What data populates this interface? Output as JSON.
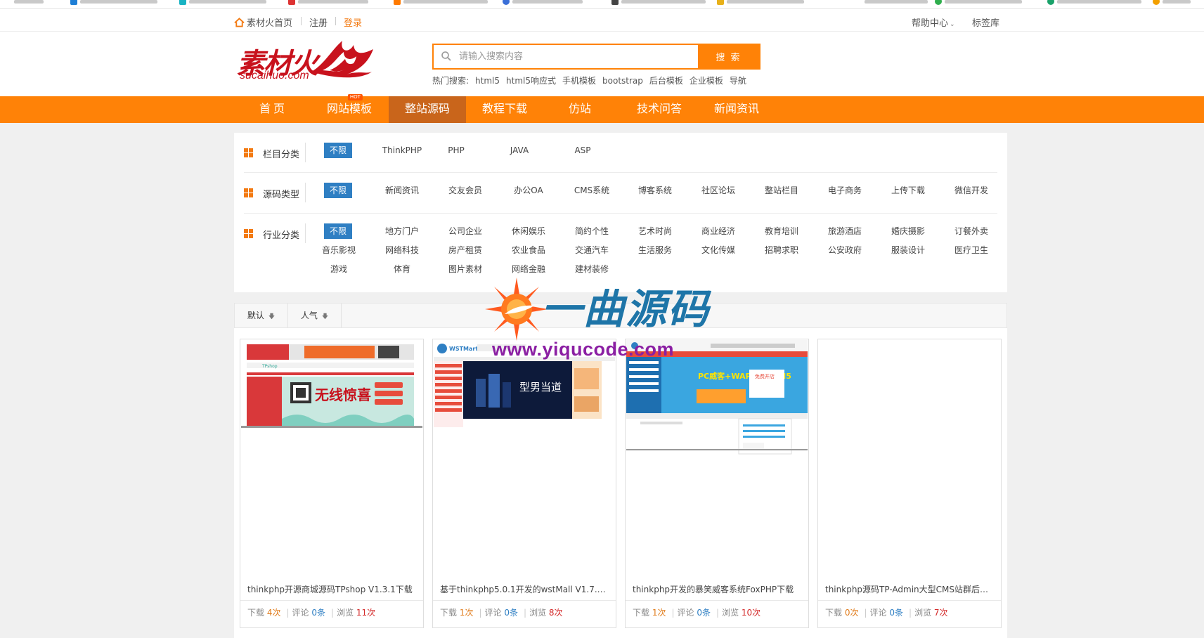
{
  "topbar": {
    "home_label": "素材火首页",
    "register": "注册",
    "login": "登录",
    "help_center": "帮助中心",
    "tag_library": "标签库"
  },
  "logo": {
    "text": "素材火",
    "domain": "sucaihuo.com"
  },
  "search": {
    "placeholder": "请输入搜索内容",
    "button": "搜 索",
    "hot_label": "热门搜索:",
    "hot_terms": [
      "html5",
      "html5响应式",
      "手机模板",
      "bootstrap",
      "后台模板",
      "企业模板",
      "导航"
    ]
  },
  "nav": {
    "items": [
      "首 页",
      "网站模板",
      "整站源码",
      "教程下载",
      "仿站",
      "技术问答",
      "新闻资讯"
    ],
    "hot_badge": "HOT",
    "active_index": 2
  },
  "filters": {
    "column": {
      "label": "栏目分类",
      "options": [
        "不限",
        "ThinkPHP",
        "PHP",
        "JAVA",
        "ASP"
      ]
    },
    "source_type": {
      "label": "源码类型",
      "options": [
        "不限",
        "新闻资讯",
        "交友会员",
        "办公OA",
        "CMS系统",
        "博客系统",
        "社区论坛",
        "整站栏目",
        "电子商务",
        "上传下载",
        "微信开发"
      ]
    },
    "industry": {
      "label": "行业分类",
      "options": [
        "不限",
        "地方门户",
        "公司企业",
        "休闲娱乐",
        "简约个性",
        "艺术时尚",
        "商业经济",
        "教育培训",
        "旅游酒店",
        "婚庆摄影",
        "订餐外卖",
        "音乐影视",
        "网络科技",
        "房产租赁",
        "农业食品",
        "交通汽车",
        "生活服务",
        "文化传媒",
        "招聘求职",
        "公安政府",
        "服装设计",
        "医疗卫生",
        "游戏",
        "体育",
        "图片素材",
        "网络金融",
        "建材装修"
      ]
    }
  },
  "sort": {
    "default": "默认",
    "popular": "人气"
  },
  "cards": [
    {
      "title": "thinkphp开源商城源码TPshop V1.3.1下载",
      "downloads": "4次",
      "comments": "0条",
      "views": "11次",
      "thumb_text": "无线惊喜"
    },
    {
      "title": "基于thinkphp5.0.1开发的wstMall V1.7.5...",
      "downloads": "1次",
      "comments": "0条",
      "views": "8次",
      "thumb_text": "型男当道",
      "thumb_brand": "WSTMart"
    },
    {
      "title": "thinkphp开发的暴笑威客系统FoxPHP下载",
      "downloads": "1次",
      "comments": "0条",
      "views": "10次",
      "thumb_text": "PC威客+WAP+移动+H5",
      "thumb_badge": "免费开店"
    },
    {
      "title": "thinkphp源码TP-Admin大型CMS站群后台...",
      "downloads": "0次",
      "comments": "0条",
      "views": "7次"
    }
  ],
  "stat_labels": {
    "download": "下载",
    "comment": "评论",
    "view": "浏览"
  },
  "watermark": {
    "text": "一曲源码",
    "url": "www.yiqucode.com"
  },
  "colors": {
    "accent_orange": "#ff8207",
    "nav_active": "#c9651b",
    "selected_blue": "#2f7fc3",
    "logo_red": "#c8121d"
  }
}
